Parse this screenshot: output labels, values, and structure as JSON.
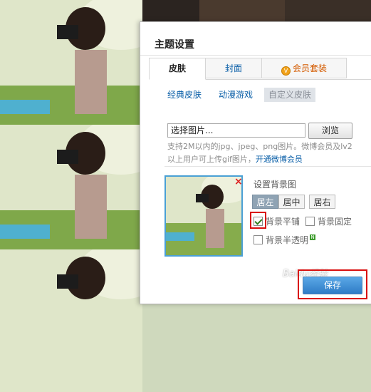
{
  "dialog": {
    "title": "主题设置",
    "tabs": [
      {
        "label": "皮肤",
        "active": true
      },
      {
        "label": "封面",
        "active": false
      },
      {
        "label": "会员套装",
        "active": false,
        "icon": "vip-icon"
      }
    ],
    "subtabs": [
      {
        "label": "经典皮肤",
        "active": false
      },
      {
        "label": "动漫游戏",
        "active": false
      },
      {
        "label": "自定义皮肤",
        "active": true
      }
    ],
    "upload": {
      "file_value": "选择图片...",
      "browse_label": "浏览",
      "hint": "支持2M以内的jpg、jpeg、png图片。微博会员及lv2以上用户可上传gif图片，",
      "hint_link": "开通微博会员"
    },
    "background": {
      "label": "设置背景图",
      "align_options": [
        {
          "label": "居左",
          "active": true
        },
        {
          "label": "居中",
          "active": false
        },
        {
          "label": "居右",
          "active": false
        }
      ],
      "tile": {
        "label": "背景平铺",
        "checked": true
      },
      "fixed": {
        "label": "背景固定",
        "checked": false
      },
      "transparent": {
        "label": "背景半透明",
        "checked": false,
        "badge": "N"
      }
    },
    "save_label": "保存"
  },
  "watermark": {
    "line1": "Baidu经验",
    "line2": "jingyan.baidu.com"
  },
  "colors": {
    "accent": "#0a5fa8",
    "highlight": "#d90f0f",
    "save": "#2e7bc6"
  }
}
